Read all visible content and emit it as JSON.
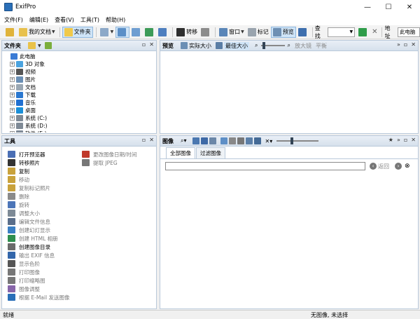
{
  "window": {
    "title": "ExifPro",
    "minimize": "—",
    "maximize": "☐",
    "close": "✕"
  },
  "menu": [
    "文件(F)",
    "编辑(E)",
    "查看(V)",
    "工具(T)",
    "帮助(H)"
  ],
  "toolbar": {
    "my_docs": "我的文档",
    "folder": "文件夹",
    "transfer": "转移",
    "window": "窗口",
    "tag": "标记",
    "preview": "预览",
    "find": "查找",
    "address": "地址",
    "address_value": "此电脑"
  },
  "folder_pane": {
    "title": "文件夹",
    "tree": [
      {
        "label": "此电脑",
        "level": 0,
        "expander": "",
        "color": "#3a7bd5"
      },
      {
        "label": "3D 对象",
        "level": 1,
        "expander": "+",
        "color": "#4aa3df"
      },
      {
        "label": "视频",
        "level": 1,
        "expander": "+",
        "color": "#555555"
      },
      {
        "label": "图片",
        "level": 1,
        "expander": "+",
        "color": "#6a8fb5"
      },
      {
        "label": "文档",
        "level": 1,
        "expander": "+",
        "color": "#9aa7b3"
      },
      {
        "label": "下载",
        "level": 1,
        "expander": "+",
        "color": "#2b78d0"
      },
      {
        "label": "音乐",
        "level": 1,
        "expander": "+",
        "color": "#1f6fd1"
      },
      {
        "label": "桌面",
        "level": 1,
        "expander": "+",
        "color": "#1a8fd8"
      },
      {
        "label": "系统 (C:)",
        "level": 1,
        "expander": "+",
        "color": "#7f8a96"
      },
      {
        "label": "系统 (D:)",
        "level": 1,
        "expander": "+",
        "color": "#7f8a96"
      },
      {
        "label": "软件 (E:)",
        "level": 1,
        "expander": "+",
        "color": "#7f8a96"
      }
    ]
  },
  "preview_pane": {
    "title": "预览",
    "actual_size": "实际大小",
    "best_size": "最佳大小",
    "magnifier": "放大镜",
    "balance": "平衡"
  },
  "tools_pane": {
    "title": "工具",
    "col1": [
      {
        "label": "打开预览器",
        "color": "#4a6fb5",
        "disabled": false
      },
      {
        "label": "转移照片",
        "color": "#333333",
        "disabled": false
      },
      {
        "label": "复制",
        "color": "#c9a23c",
        "disabled": false
      },
      {
        "label": "移动",
        "color": "#c9a23c",
        "disabled": true
      },
      {
        "label": "复制标记照片",
        "color": "#c9a23c",
        "disabled": true
      },
      {
        "label": "删除",
        "color": "#8a8a8a",
        "disabled": true
      },
      {
        "label": "旋转",
        "color": "#4c75b8",
        "disabled": true
      },
      {
        "label": "调整大小",
        "color": "#7d8a96",
        "disabled": true
      },
      {
        "label": "编辑文件信息",
        "color": "#5a6e8a",
        "disabled": true
      },
      {
        "label": "创建幻灯显示",
        "color": "#3b7fc4",
        "disabled": true
      },
      {
        "label": "创建 HTML 相册",
        "color": "#2f8f4e",
        "disabled": true
      },
      {
        "label": "创建图像目录",
        "color": "#6b6b6b",
        "disabled": false
      },
      {
        "label": "输出 EXIF 信息",
        "color": "#3366aa",
        "disabled": true
      },
      {
        "label": "显示色阶",
        "color": "#555555",
        "disabled": true
      },
      {
        "label": "打印图像",
        "color": "#777777",
        "disabled": true
      },
      {
        "label": "打印缩略图",
        "color": "#777777",
        "disabled": true
      },
      {
        "label": "图像调整",
        "color": "#8866aa",
        "disabled": true
      },
      {
        "label": "根据 E-Mail 发送图像",
        "color": "#2a6fb8",
        "disabled": true
      }
    ],
    "col2": [
      {
        "label": "更改图像日期/时间",
        "color": "#c0392b",
        "disabled": true
      },
      {
        "label": "提取 JPEG",
        "color": "#777777",
        "disabled": true
      }
    ]
  },
  "images_pane": {
    "title": "图像",
    "tab_all": "全部图像",
    "tab_filter": "过滤图像",
    "back_label": "返回"
  },
  "status": {
    "left": "就绪",
    "right": "无图像, 未选择"
  }
}
